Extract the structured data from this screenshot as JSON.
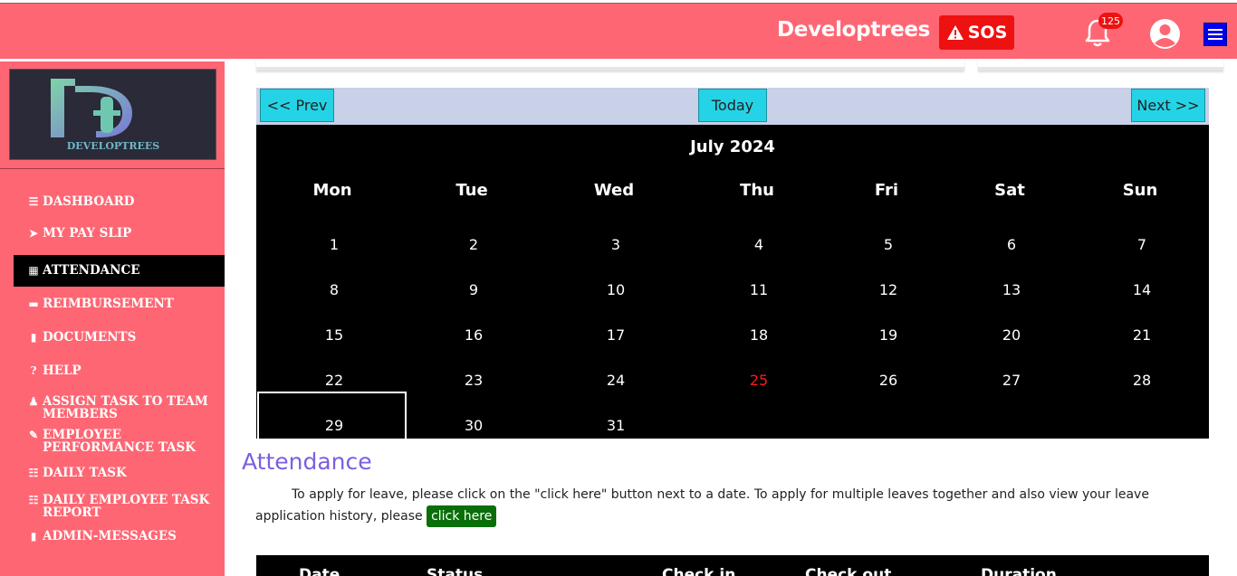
{
  "header": {
    "brand": "Developtrees",
    "sos_label": "SOS",
    "notification_count": "125",
    "brand_color": "#ff6673"
  },
  "sidebar": {
    "logo_text": "DEVELOPTREES",
    "items": [
      {
        "icon": "bars-icon",
        "label": "DASHBOARD"
      },
      {
        "icon": "paper-plane-icon",
        "label": "MY PAY SLIP"
      },
      {
        "icon": "calendar-icon",
        "label": "ATTENDANCE",
        "active": true
      },
      {
        "icon": "credit-card-icon",
        "label": "REIMBURSEMENT"
      },
      {
        "icon": "file-icon",
        "label": "DOCUMENTS"
      },
      {
        "icon": "question-circle-icon",
        "label": "HELP"
      },
      {
        "icon": "users-icon",
        "label": "ASSIGN TASK TO TEAM MEMBERS"
      },
      {
        "icon": "user-edit-icon",
        "label": "EMPLOYEE PERFORMANCE TASK"
      },
      {
        "icon": "tasks-icon",
        "label": "DAILY TASK"
      },
      {
        "icon": "tasks-icon",
        "label": "DAILY EMPLOYEE TASK REPORT"
      },
      {
        "icon": "file-icon",
        "label": "ADMIN-MESSAGES"
      }
    ]
  },
  "calendar": {
    "prev_label": "<< Prev",
    "today_label": "Today",
    "next_label": "Next >>",
    "month_title": "July 2024",
    "weekdays": [
      "Mon",
      "Tue",
      "Wed",
      "Thu",
      "Fri",
      "Sat",
      "Sun"
    ],
    "weeks": [
      [
        "1",
        "2",
        "3",
        "4",
        "5",
        "6",
        "7"
      ],
      [
        "8",
        "9",
        "10",
        "11",
        "12",
        "13",
        "14"
      ],
      [
        "15",
        "16",
        "17",
        "18",
        "19",
        "20",
        "21"
      ],
      [
        "22",
        "23",
        "24",
        "25",
        "26",
        "27",
        "28"
      ],
      [
        "29",
        "30",
        "31",
        "",
        "",
        "",
        ""
      ]
    ],
    "today": "25",
    "selected": "29",
    "today_color": "#ff1a1a"
  },
  "attendance": {
    "title": "Attendance",
    "instructions": "To apply for leave, please click on the \"click here\" button next to a date. To apply for multiple leaves together and also view your leave application history, please",
    "click_here_label": "click here"
  },
  "table": {
    "headers": [
      "Date",
      "Status",
      "Check in",
      "Check out",
      "Duration"
    ]
  }
}
